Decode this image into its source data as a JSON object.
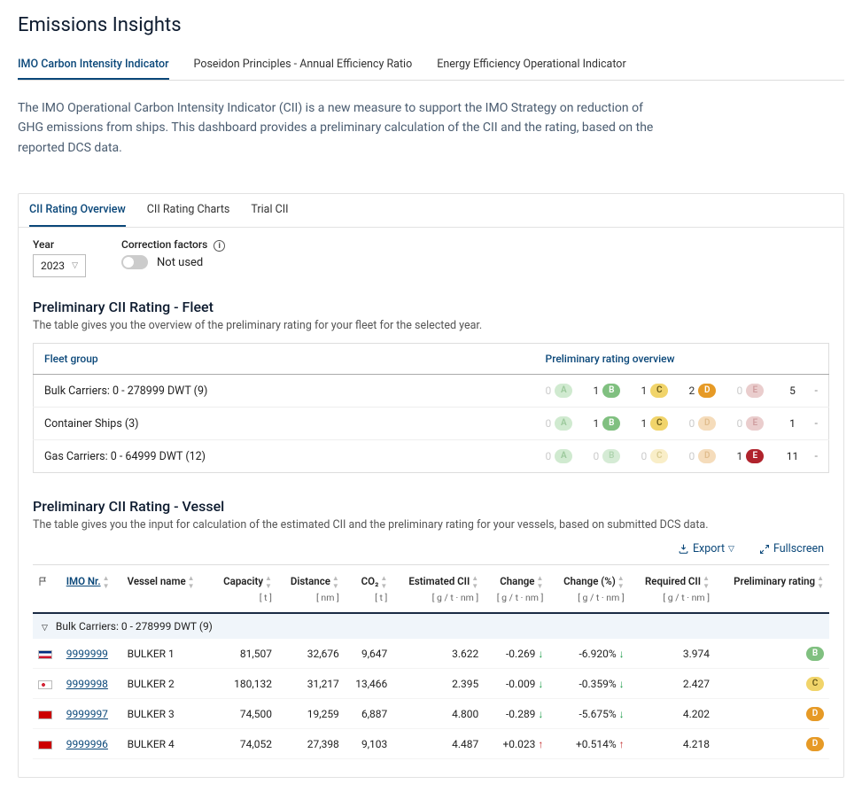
{
  "page_title": "Emissions Insights",
  "tabs_primary": [
    {
      "id": "cii",
      "label": "IMO Carbon Intensity Indicator",
      "active": true
    },
    {
      "id": "poseidon",
      "label": "Poseidon Principles - Annual Efficiency Ratio",
      "active": false
    },
    {
      "id": "eeoi",
      "label": "Energy Efficiency Operational Indicator",
      "active": false
    }
  ],
  "intro_text": "The IMO Operational Carbon Intensity Indicator (CII) is a new measure to support the IMO Strategy on reduction of GHG emissions from ships. This dashboard provides a preliminary calculation of the CII and the rating, based on the reported DCS data.",
  "tabs_secondary": [
    {
      "id": "overview",
      "label": "CII Rating Overview",
      "active": true
    },
    {
      "id": "charts",
      "label": "CII Rating Charts",
      "active": false
    },
    {
      "id": "trial",
      "label": "Trial CII",
      "active": false
    }
  ],
  "year": {
    "label": "Year",
    "value": "2023"
  },
  "correction": {
    "label": "Correction factors",
    "value": "Not used"
  },
  "fleet_section": {
    "title": "Preliminary CII Rating - Fleet",
    "subtitle": "The table gives you the overview of the preliminary rating for your fleet for the selected year.",
    "col_group": "Fleet group",
    "col_overview": "Preliminary rating overview"
  },
  "fleet_rows": [
    {
      "name": "Bulk Carriers: 0 - 278999 DWT (9)",
      "A": 0,
      "B": 1,
      "C": 1,
      "D": 2,
      "E": 0,
      "count": 5,
      "extra": "-"
    },
    {
      "name": "Container Ships (3)",
      "A": 0,
      "B": 1,
      "C": 1,
      "D": 0,
      "E": 0,
      "count": 1,
      "extra": "-"
    },
    {
      "name": "Gas Carriers: 0 - 64999 DWT (12)",
      "A": 0,
      "B": 0,
      "C": 0,
      "D": 0,
      "E": 1,
      "count": 11,
      "extra": "-"
    }
  ],
  "vessel_section": {
    "title": "Preliminary CII Rating - Vessel",
    "subtitle": "The table gives you the input for calculation of the estimated CII and the preliminary rating for your vessels, based on submitted DCS data."
  },
  "actions": {
    "export": "Export",
    "fullscreen": "Fullscreen"
  },
  "vessel_cols": {
    "flag": "",
    "imo": "IMO Nr.",
    "name": "Vessel name",
    "cap": {
      "h": "Capacity",
      "u": "[ t ]"
    },
    "dist": {
      "h": "Distance",
      "u": "[ nm ]"
    },
    "co2": {
      "h": "CO₂",
      "u": "[ t ]"
    },
    "est": {
      "h": "Estimated CII",
      "u": "[ g / t · nm ]"
    },
    "chg": {
      "h": "Change",
      "u": "[ g / t · nm ]"
    },
    "chgp": {
      "h": "Change (%)",
      "u": "[ g / t · nm ]"
    },
    "req": {
      "h": "Required CII",
      "u": "[ g / t · nm ]"
    },
    "prelim": "Preliminary rating"
  },
  "group_label": "Bulk Carriers: 0 - 278999 DWT (9)",
  "vessel_rows": [
    {
      "flag": 0,
      "imo": "9999999",
      "name": "BULKER 1",
      "cap": "81,507",
      "dist": "32,676",
      "co2": "9,647",
      "est": "3.622",
      "chg": "-0.269",
      "chgp": "-6.920%",
      "dir": "down",
      "req": "3.974",
      "rating": "B"
    },
    {
      "flag": 1,
      "imo": "9999998",
      "name": "BULKER 2",
      "cap": "180,132",
      "dist": "31,217",
      "co2": "13,466",
      "est": "2.395",
      "chg": "-0.009",
      "chgp": "-0.359%",
      "dir": "down",
      "req": "2.427",
      "rating": "C"
    },
    {
      "flag": 2,
      "imo": "9999997",
      "name": "BULKER 3",
      "cap": "74,500",
      "dist": "19,259",
      "co2": "6,887",
      "est": "4.800",
      "chg": "-0.289",
      "chgp": "-5.675%",
      "dir": "down",
      "req": "4.202",
      "rating": "D"
    },
    {
      "flag": 2,
      "imo": "9999996",
      "name": "BULKER 4",
      "cap": "74,052",
      "dist": "27,398",
      "co2": "9,103",
      "est": "4.487",
      "chg": "+0.023",
      "chgp": "+0.514%",
      "dir": "up",
      "req": "4.218",
      "rating": "D"
    }
  ]
}
